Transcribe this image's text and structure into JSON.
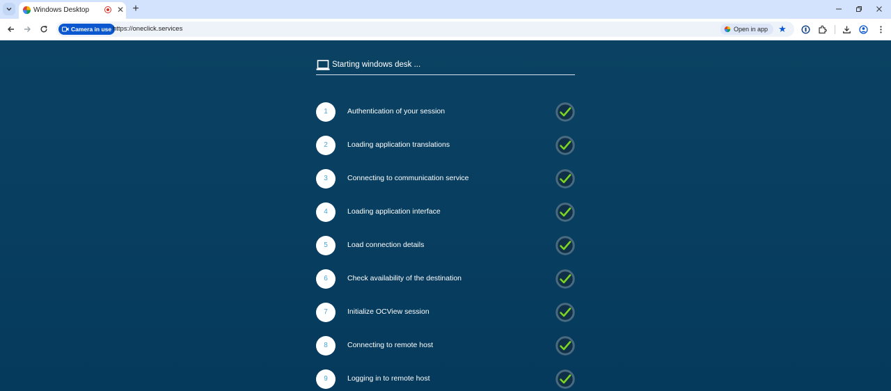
{
  "browser": {
    "tab": {
      "title": "Windows Desktop"
    },
    "address": {
      "camera_chip": "Camera in use",
      "url": "https://oneclick.services",
      "open_in_app": "Open in app"
    }
  },
  "panel": {
    "title": "Starting windows desk ...",
    "steps": [
      {
        "num": "1",
        "label": "Authentication of your session"
      },
      {
        "num": "2",
        "label": "Loading application translations"
      },
      {
        "num": "3",
        "label": "Connecting to communication service"
      },
      {
        "num": "4",
        "label": "Loading application interface"
      },
      {
        "num": "5",
        "label": "Load connection details"
      },
      {
        "num": "6",
        "label": "Check availability of the destination"
      },
      {
        "num": "7",
        "label": "Initialize OCView session"
      },
      {
        "num": "8",
        "label": "Connecting to remote host"
      },
      {
        "num": "9",
        "label": "Logging in to remote host"
      }
    ]
  },
  "colors": {
    "background": "#0b3f60",
    "check_green": "#7ed321",
    "step_number": "#4ba3d8",
    "accent": "#0b57d0"
  }
}
